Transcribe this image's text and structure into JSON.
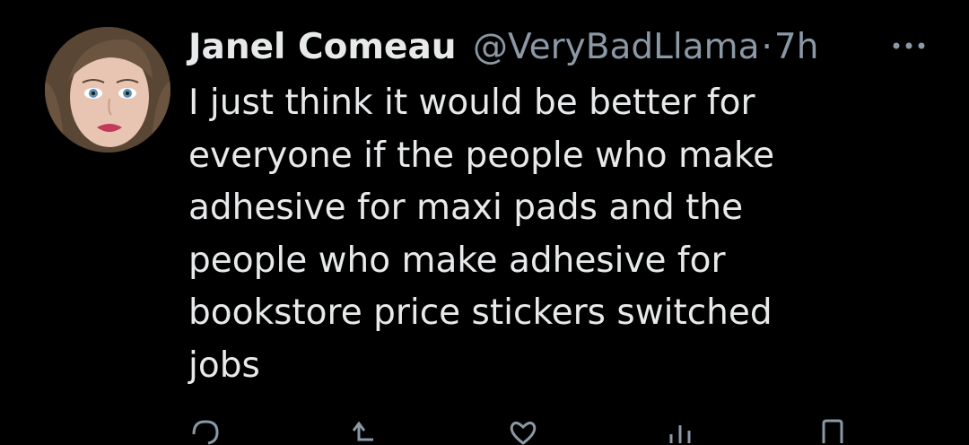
{
  "tweet": {
    "author": {
      "display_name": "Janel Comeau",
      "handle": "@VeryBadLlama",
      "avatar_icon": "profile-photo"
    },
    "separator": "·",
    "timestamp": "7h",
    "more_icon": "ellipsis-icon",
    "text": "I just think it would be better for\neveryone if the people who make\nadhesive for maxi pads and the\npeople who make adhesive for\nbookstore price stickers switched\njobs",
    "actions": [
      "reply-icon",
      "retweet-icon",
      "like-icon",
      "views-icon",
      "bookmark-icon"
    ]
  },
  "colors": {
    "background": "#000000",
    "text_primary": "#e7e9ea",
    "text_secondary": "#8b98a5"
  }
}
